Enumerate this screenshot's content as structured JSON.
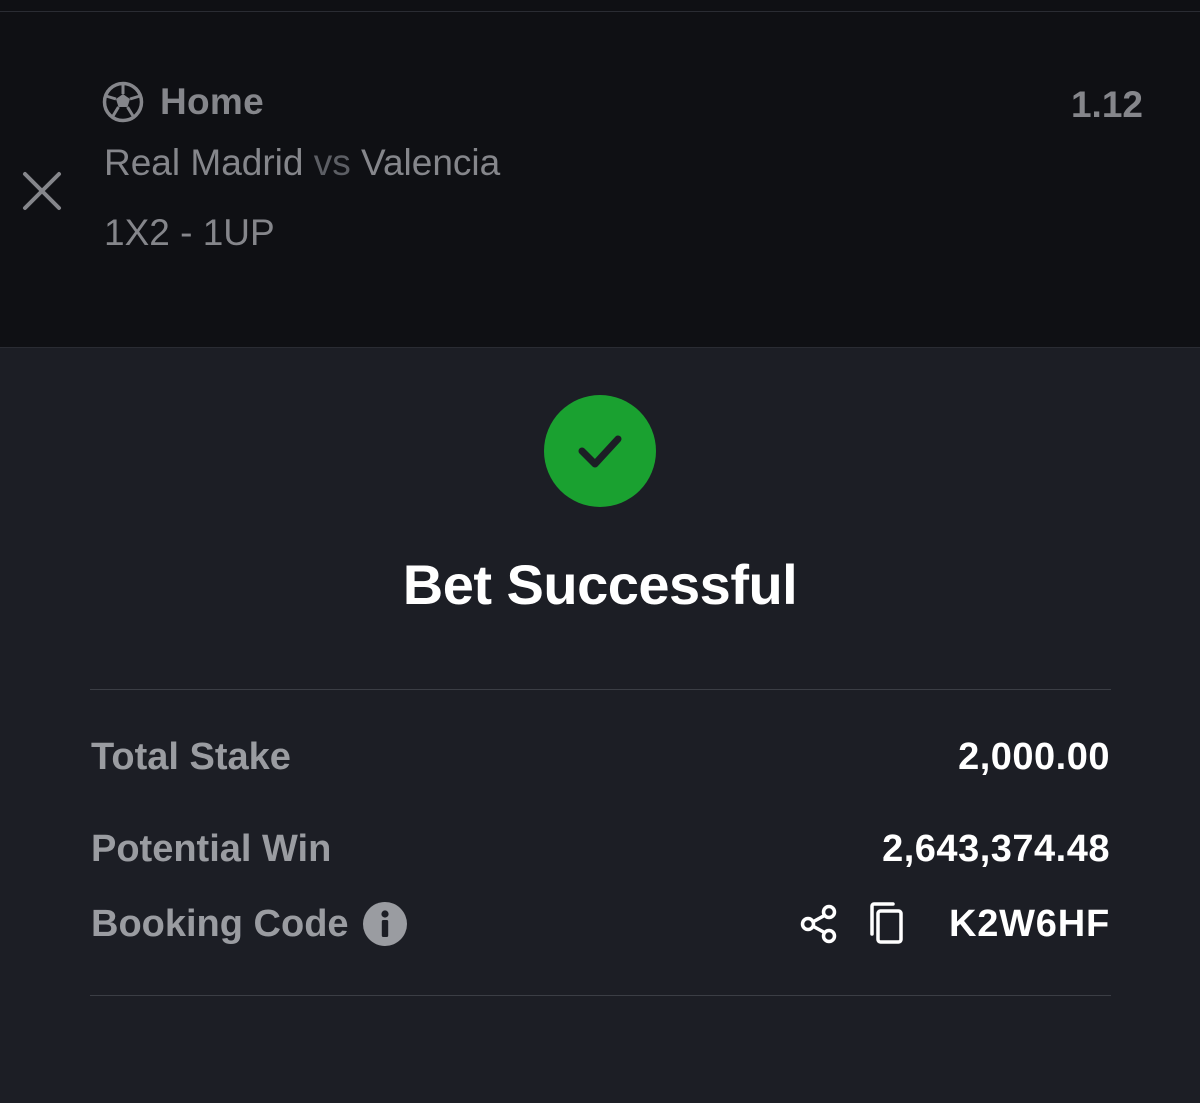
{
  "selection": {
    "pick": "Home",
    "odds": "1.12",
    "home_team": "Real Madrid",
    "vs": "vs",
    "away_team": "Valencia",
    "market": "1X2 - 1UP",
    "sport_icon": "soccer-ball-icon",
    "remove_icon": "close-icon"
  },
  "result": {
    "status_icon": "check-circle-icon",
    "title": "Bet Successful"
  },
  "summary": {
    "total_stake_label": "Total Stake",
    "total_stake_value": "2,000.00",
    "potential_win_label": "Potential Win",
    "potential_win_value": "2,643,374.48",
    "booking_code_label": "Booking Code",
    "booking_code_value": "K2W6HF",
    "info_icon": "info-icon",
    "share_icon": "share-icon",
    "copy_icon": "copy-icon"
  },
  "colors": {
    "background": "#1c1e25",
    "card": "#0f1014",
    "success": "#1aa130",
    "muted_text": "#85868b",
    "value_text": "#ffffff"
  }
}
